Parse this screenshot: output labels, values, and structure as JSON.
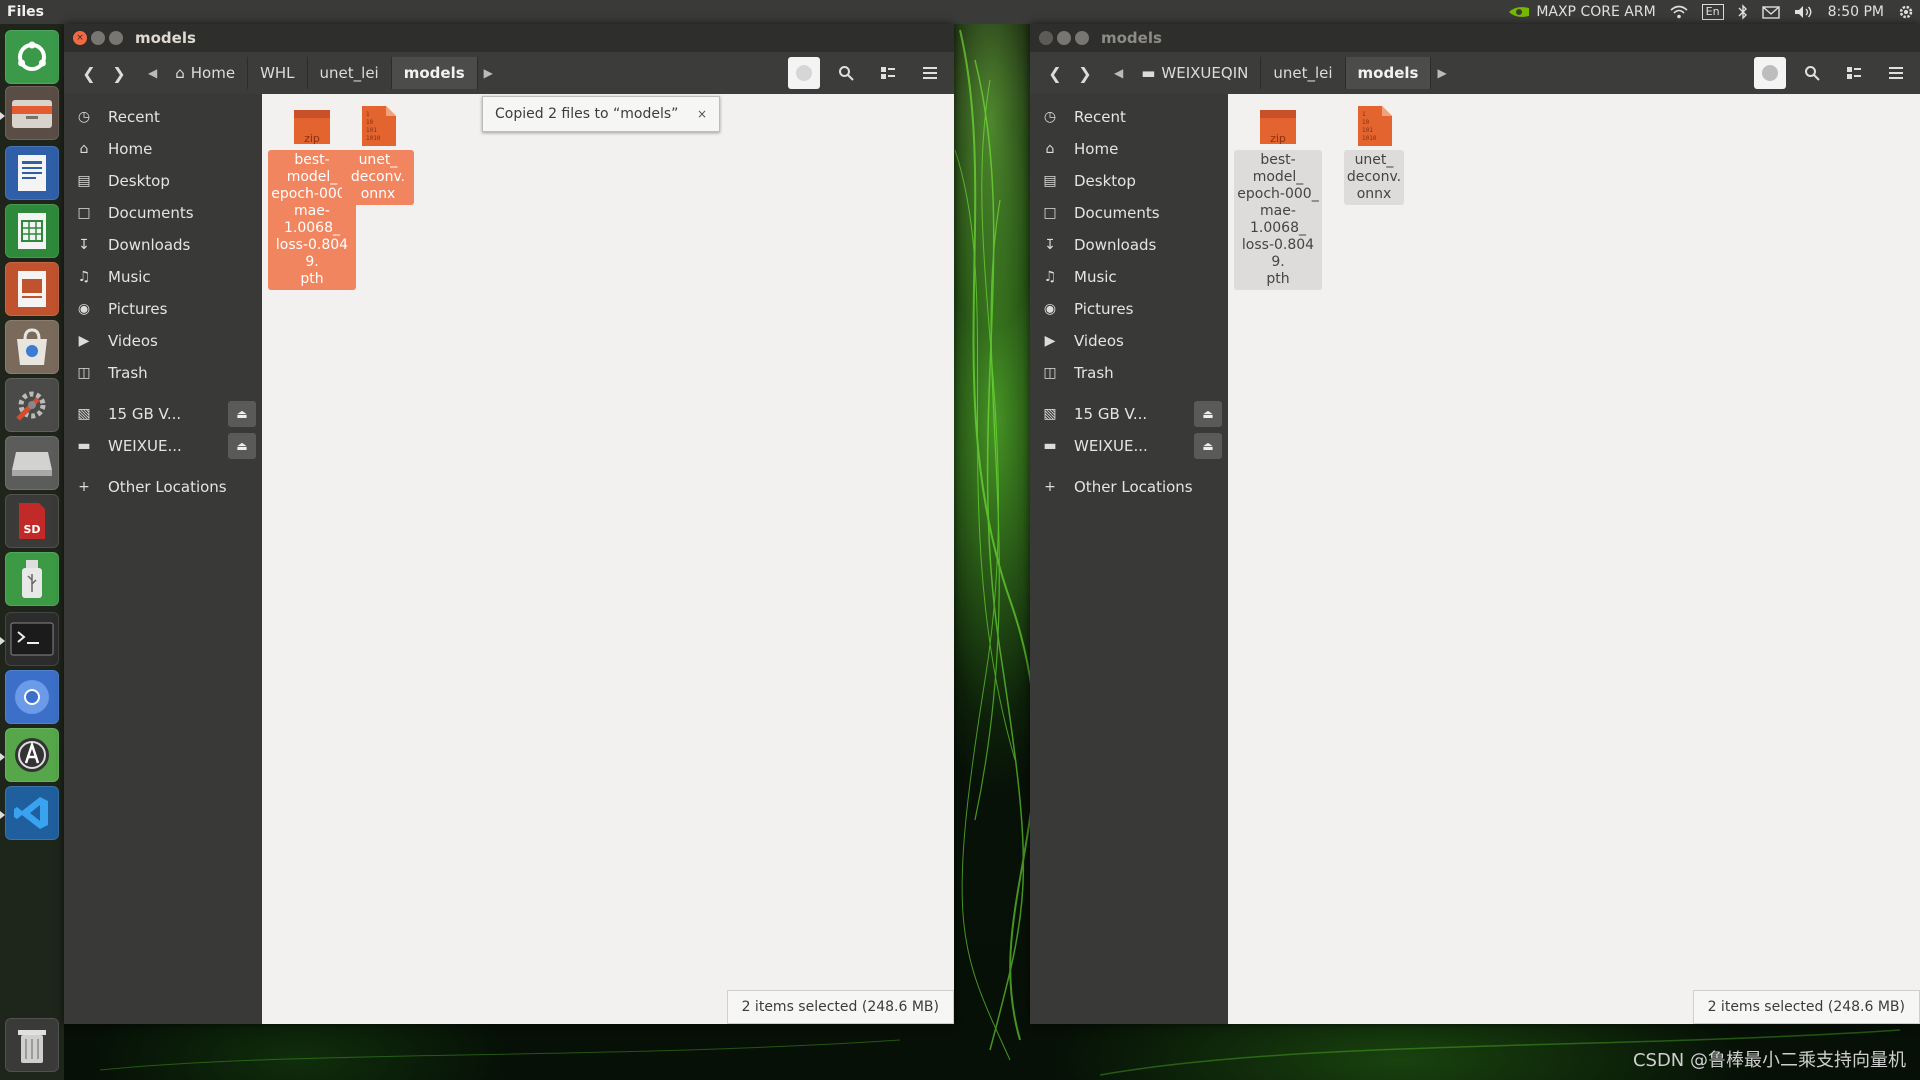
{
  "top_panel": {
    "app_name": "Files",
    "network_label": "MAXP CORE ARM",
    "keyboard": "En",
    "time": "8:50 PM"
  },
  "launcher": {
    "items": [
      "ubuntu-dash",
      "files",
      "writer",
      "calc",
      "impress",
      "software-store",
      "system-settings",
      "drive",
      "sd-card",
      "usb-drive",
      "terminal",
      "chromium",
      "software-updater",
      "vscode",
      "trash"
    ]
  },
  "left_window": {
    "title": "models",
    "breadcrumbs": [
      "Home",
      "WHL",
      "unet_lei",
      "models"
    ],
    "toast": "Copied 2 files to “models”",
    "status": "2 items selected  (248.6 MB)"
  },
  "right_window": {
    "title": "models",
    "breadcrumbs": [
      "WEIXUEQIN",
      "unet_lei",
      "models"
    ],
    "status": "2 items selected  (248.6 MB)"
  },
  "sidebar": {
    "items": [
      "Recent",
      "Home",
      "Desktop",
      "Documents",
      "Downloads",
      "Music",
      "Pictures",
      "Videos",
      "Trash"
    ],
    "devices": [
      "15 GB V...",
      "WEIXUE..."
    ],
    "other": "Other Locations"
  },
  "files": {
    "f1": {
      "name": "best-model_epoch-000_mae-1.0068_loss-0.8049.pth",
      "lines": [
        "best-",
        "model_",
        "epoch-000_",
        "mae-",
        "1.0068_",
        "loss-0.8049.",
        "pth"
      ],
      "badge": "zip"
    },
    "f2": {
      "name": "unet_deconv.onnx",
      "lines": [
        "unet_",
        "deconv.",
        "onnx"
      ],
      "badge": "1 10 101 1010"
    }
  },
  "watermark": "CSDN @鲁棒最小二乘支持向量机",
  "colors": {
    "accent": "#f0855f",
    "file_icon": "#e3642f",
    "launcher_bg": "#22281e"
  }
}
